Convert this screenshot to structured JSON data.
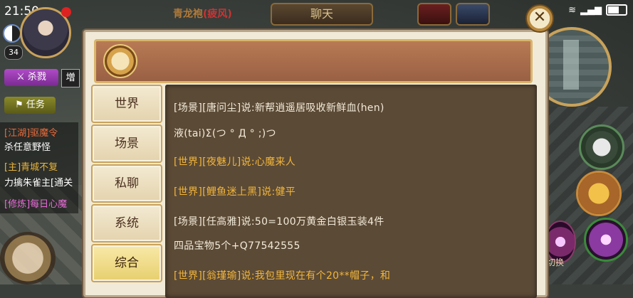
{
  "status": {
    "time": "21:50",
    "notification_count": ""
  },
  "hud": {
    "player_title": "青龙袍",
    "player_title_tag": "(疲风)",
    "chat_tab": "聊天",
    "level": "34",
    "kill_label": "杀戮",
    "side_label": "増",
    "task_label": "任务"
  },
  "quests": [
    {
      "tag": "[江湖]驱魔令",
      "desc": "杀任意野怪"
    },
    {
      "tag": "[主]青城不复",
      "desc": "力擒朱雀主[通关"
    },
    {
      "tag": "[修炼]每日心魔",
      "desc": ""
    }
  ],
  "dialog": {
    "tabs": [
      "世界",
      "场景",
      "私聊",
      "系统",
      "综合"
    ],
    "active_tab": "综合",
    "messages": [
      {
        "channel": "scene",
        "text": "[场景][唐问尘]说:新帮逍遥居吸收新鲜血(hen)"
      },
      {
        "channel": "scene",
        "text": "液(tai)Σ(つ °  Д °  ;)つ"
      },
      {
        "channel": "world",
        "text": "[世界][夜魅儿]说:心魔来人"
      },
      {
        "channel": "world",
        "text": "[世界][鲤鱼迷上黑]说:健平"
      },
      {
        "channel": "scene",
        "text": "[场景][任高雅]说:50=100万黄金白银玉装4件"
      },
      {
        "channel": "scene",
        "text": "四品宝物5个+Q77542555"
      },
      {
        "channel": "world",
        "text": "[世界][翁瑾瑜]说:我包里现在有个20**帽子，和"
      }
    ]
  },
  "skills": {
    "bottom_label": "切换"
  },
  "icons": [
    "close-icon",
    "scroll-icon",
    "mask-icon",
    "boot-icon",
    "skill-icon",
    "taiji-icon",
    "minimap-icon"
  ],
  "colors": {
    "world_channel": "#f2b53a",
    "scene_channel": "#f2ead8",
    "dialog_bg": "#f1ead8",
    "message_bg": "#5b4a36"
  }
}
